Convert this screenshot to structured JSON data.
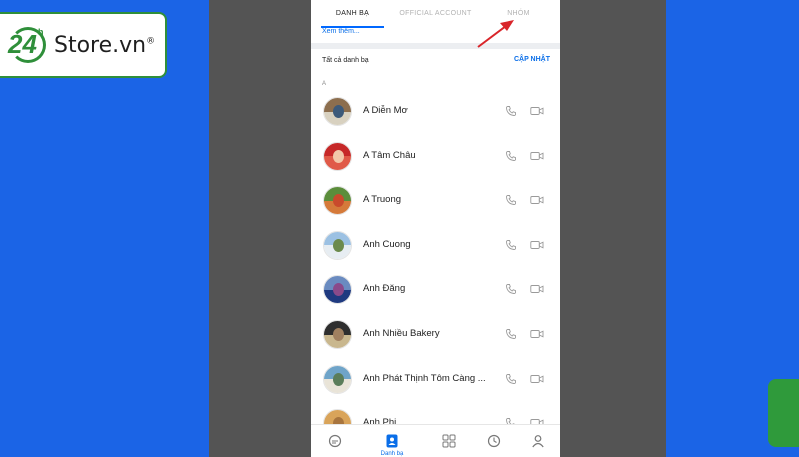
{
  "brand": {
    "logo_number": "24",
    "logo_small": "h",
    "logo_text": "Store.vn",
    "logo_reg": "®"
  },
  "tabs": [
    {
      "label": "DANH BẠ",
      "active": true
    },
    {
      "label": "OFFICIAL ACCOUNT",
      "active": false
    },
    {
      "label": "NHÓM",
      "active": false
    }
  ],
  "see_more": "Xem thêm...",
  "all_contacts": {
    "title": "Tất cả danh bạ",
    "update_label": "CẬP NHẬT"
  },
  "section_letter": "A",
  "contacts": [
    {
      "name": "A Diễn Mơ",
      "colors": [
        "#8c6e4e",
        "#d8d1c0",
        "#3c5a7a"
      ]
    },
    {
      "name": "A Tâm Châu",
      "colors": [
        "#c62828",
        "#e05a48",
        "#f2c7a8"
      ]
    },
    {
      "name": "A Truong",
      "colors": [
        "#5b8d3b",
        "#d57a3a",
        "#c94a2c"
      ]
    },
    {
      "name": "Anh Cuong",
      "colors": [
        "#9cc1e3",
        "#e7edf2",
        "#6b8a4c"
      ]
    },
    {
      "name": "Anh Đăng",
      "colors": [
        "#6a8bc0",
        "#1f3a80",
        "#8a4a8a"
      ]
    },
    {
      "name": "Anh Nhiều Bakery",
      "colors": [
        "#2e2e2e",
        "#c9b78e",
        "#a08060"
      ]
    },
    {
      "name": "Anh Phát Thịnh Tôm Càng ...",
      "colors": [
        "#6fa4c9",
        "#e9e4d8",
        "#5b7d5a"
      ]
    },
    {
      "name": "Anh Phi",
      "colors": [
        "#d9a45a",
        "#f0c888",
        "#a8753e"
      ]
    }
  ],
  "nav": [
    {
      "icon": "chat-icon",
      "label": ""
    },
    {
      "icon": "contacts-icon",
      "label": "Danh bạ",
      "active": true
    },
    {
      "icon": "discover-icon",
      "label": ""
    },
    {
      "icon": "timeline-icon",
      "label": ""
    },
    {
      "icon": "profile-icon",
      "label": ""
    }
  ],
  "colors": {
    "background": "#1b64e6",
    "accent": "#0068ff",
    "brand_green": "#2f8f3a",
    "arrow": "#d9252a"
  }
}
